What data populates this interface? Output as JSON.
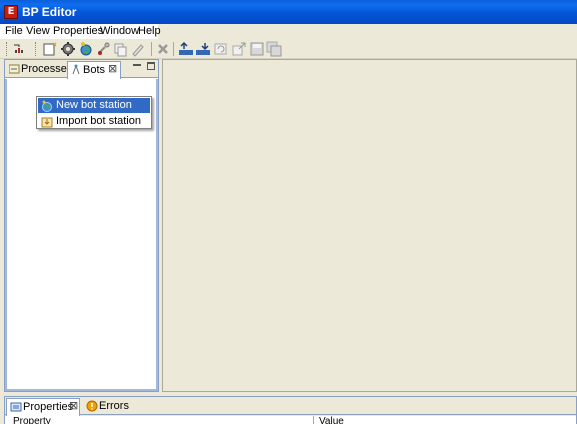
{
  "window": {
    "title": "BP Editor",
    "icon": "app-logo-icon"
  },
  "menubar": {
    "items": [
      "File",
      "View",
      "Properties",
      "Window",
      "Help"
    ]
  },
  "toolbar": {
    "buttons": [
      "new-process-icon",
      "new-folder-icon",
      "gear-icon",
      "globe-icon",
      "connect-icon",
      "copy-icon",
      "edit-icon",
      "delete-icon",
      "upload-icon",
      "download-icon",
      "refresh-icon",
      "export-icon",
      "save-icon",
      "save-all-icon"
    ]
  },
  "left_panel": {
    "tabs": [
      {
        "label": "Processes",
        "icon": "processes-icon"
      },
      {
        "label": "Bots",
        "icon": "bots-icon",
        "close": "⊠"
      }
    ]
  },
  "context_menu": {
    "items": [
      {
        "label": "New bot station",
        "icon": "bot-station-icon",
        "selected": true
      },
      {
        "label": "Import bot station",
        "icon": "import-icon",
        "selected": false
      }
    ]
  },
  "bottom_panel": {
    "tabs": [
      {
        "label": "Properties",
        "icon": "properties-icon",
        "close": "⊠"
      },
      {
        "label": "Errors",
        "icon": "warning-icon"
      }
    ],
    "columns": [
      "Property",
      "Value"
    ]
  },
  "colors": {
    "titlebar": "#0554d6",
    "selection": "#316ac5",
    "panel_border": "#8a9fc4",
    "background": "#ece9d8"
  }
}
